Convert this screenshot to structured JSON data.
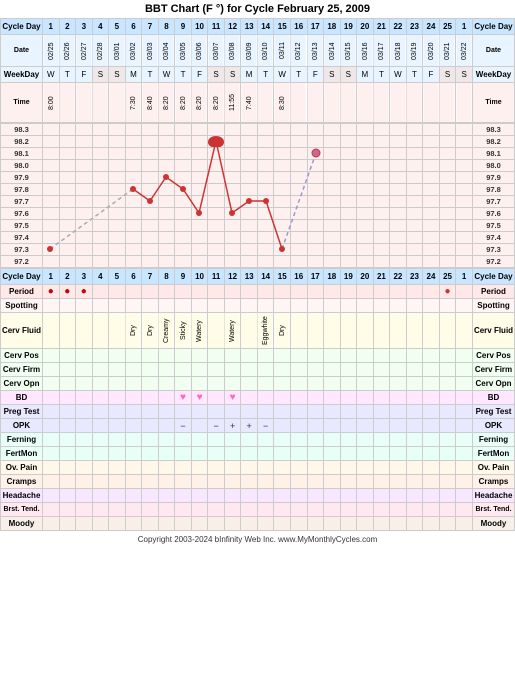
{
  "title": "BBT Chart (F °) for Cycle February 25, 2009",
  "footer": "Copyright 2003-2024 bInfinity Web Inc.   www.MyMonthlyCycles.com",
  "cycleDays": [
    "1",
    "2",
    "3",
    "4",
    "5",
    "6",
    "7",
    "8",
    "9",
    "10",
    "11",
    "12",
    "13",
    "14",
    "15",
    "16",
    "17",
    "18",
    "19",
    "20",
    "21",
    "22",
    "23",
    "24",
    "25",
    "1"
  ],
  "dates": [
    "02/25",
    "02/26",
    "02/27",
    "02/28",
    "03/01",
    "03/02",
    "03/03",
    "03/04",
    "03/05",
    "03/06",
    "03/07",
    "03/08",
    "03/09",
    "03/10",
    "03/11",
    "03/12",
    "03/13",
    "03/14",
    "03/15",
    "03/16",
    "03/17",
    "03/18",
    "03/19",
    "03/20",
    "03/21",
    "03/22"
  ],
  "weekdays": [
    "W",
    "T",
    "F",
    "S",
    "S",
    "M",
    "T",
    "W",
    "T",
    "F",
    "S",
    "S",
    "M",
    "T",
    "W",
    "T",
    "F",
    "S",
    "S",
    "M",
    "T",
    "W",
    "T",
    "F",
    "S",
    "S"
  ],
  "times": [
    "8:00",
    "",
    "",
    "",
    "",
    "7:30",
    "8:40",
    "8:20",
    "8:20",
    "8:20",
    "8:20",
    "11:55",
    "7:40",
    "",
    "8:30",
    "",
    "",
    "",
    "",
    "",
    "",
    "",
    "",
    "",
    "",
    ""
  ],
  "tempLabels": [
    "98.3",
    "98.2",
    "98.1",
    "98.0",
    "97.9",
    "97.8",
    "97.7",
    "97.6",
    "97.5",
    "97.4",
    "97.3",
    "97.2"
  ],
  "temps": {
    "1": 97.3,
    "6": 97.8,
    "7": 97.7,
    "8": 97.9,
    "9": 97.8,
    "10": 97.6,
    "11": 98.2,
    "12": 97.6,
    "13": 97.7,
    "14": 97.7,
    "15": 97.3,
    "17": 98.1
  },
  "rows": {
    "period": {
      "1": "dot",
      "2": "dot",
      "3": "dot",
      "25": "dot"
    },
    "spotting": {},
    "cervFluid": {
      "6": "Dry",
      "7": "Dry",
      "8": "Creamy",
      "9": "Sticky",
      "10": "Watery",
      "12": "Watery",
      "14": "Eggwhite",
      "15": "Dry"
    },
    "cervPos": {},
    "cervFirm": {},
    "cervOpn": {},
    "bd": {
      "9": "heart",
      "10": "heart",
      "12": "heart"
    },
    "pregTest": {},
    "opk": {
      "9": "−",
      "11": "−",
      "12": "+",
      "13": "+",
      "14": "−"
    },
    "ferning": {},
    "fertMon": {},
    "ovPain": {},
    "cramps": {},
    "headache": {},
    "brstTend": {},
    "moody": {}
  },
  "labels": {
    "cycleDay": "Cycle Day",
    "date": "Date",
    "weekDay": "WeekDay",
    "time": "Time",
    "period": "Period",
    "spotting": "Spotting",
    "cervFluid": "Cerv Fluid",
    "cervPos": "Cerv Pos",
    "cervFirm": "Cerv Firm",
    "cervOpn": "Cerv Opn",
    "bd": "BD",
    "pregTest": "Preg Test",
    "opk": "OPK",
    "ferning": "Ferning",
    "fertMon": "FertMon",
    "ovPain": "Ov. Pain",
    "cramps": "Cramps",
    "headache": "Headache",
    "brstTend": "Brst. Tend.",
    "moody": "Moody"
  }
}
